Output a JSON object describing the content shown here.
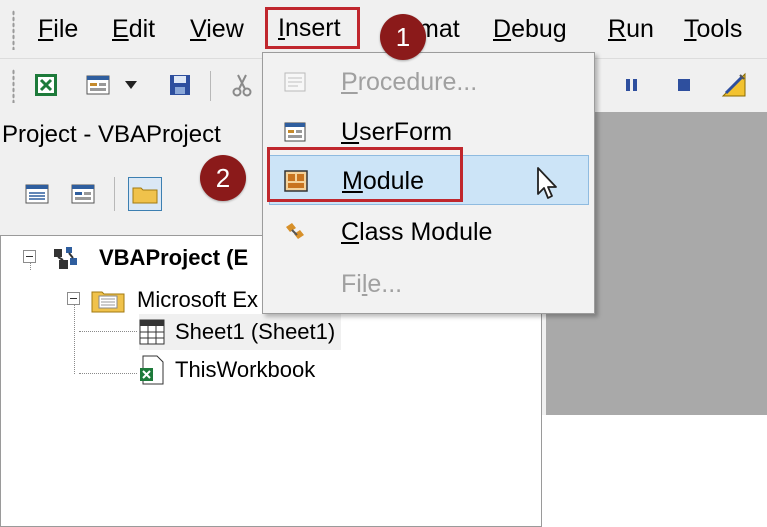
{
  "menubar": {
    "items": [
      {
        "label": "File",
        "ul": "F",
        "rest": "ile"
      },
      {
        "label": "Edit",
        "ul": "E",
        "rest": "dit"
      },
      {
        "label": "View",
        "ul": "V",
        "rest": "iew"
      },
      {
        "label": "Insert",
        "ul": "I",
        "rest": "nsert"
      },
      {
        "label": "Format",
        "visible_tail": "mat"
      },
      {
        "label": "Debug",
        "ul": "D",
        "rest": "ebug"
      },
      {
        "label": "Run",
        "ul": "R",
        "rest": "un"
      },
      {
        "label": "Tools",
        "ul": "T",
        "rest": "ools"
      }
    ]
  },
  "project_panel": {
    "title": "Project - VBAProject"
  },
  "tree": {
    "root": "VBAProject (E",
    "folder": "Microsoft Ex",
    "sheet": "Sheet1 (Sheet1)",
    "workbook": "ThisWorkbook"
  },
  "insert_menu": {
    "items": [
      {
        "ul": "P",
        "rest": "rocedure...",
        "enabled": false,
        "icon": "procedure-icon"
      },
      {
        "ul": "U",
        "rest": "serForm",
        "enabled": true,
        "icon": "userform-icon"
      },
      {
        "ul": "M",
        "rest": "odule",
        "enabled": true,
        "icon": "module-icon",
        "highlighted": true
      },
      {
        "ul": "C",
        "rest": "lass Module",
        "enabled": true,
        "icon": "class-module-icon"
      },
      {
        "pre": "Fi",
        "ul": "l",
        "rest": "e...",
        "enabled": false,
        "icon": ""
      }
    ]
  },
  "badges": {
    "step1": "1",
    "step2": "2"
  },
  "colors": {
    "callout": "#c0272d",
    "badge": "#8b1a1a",
    "highlight": "#cce4f7"
  }
}
